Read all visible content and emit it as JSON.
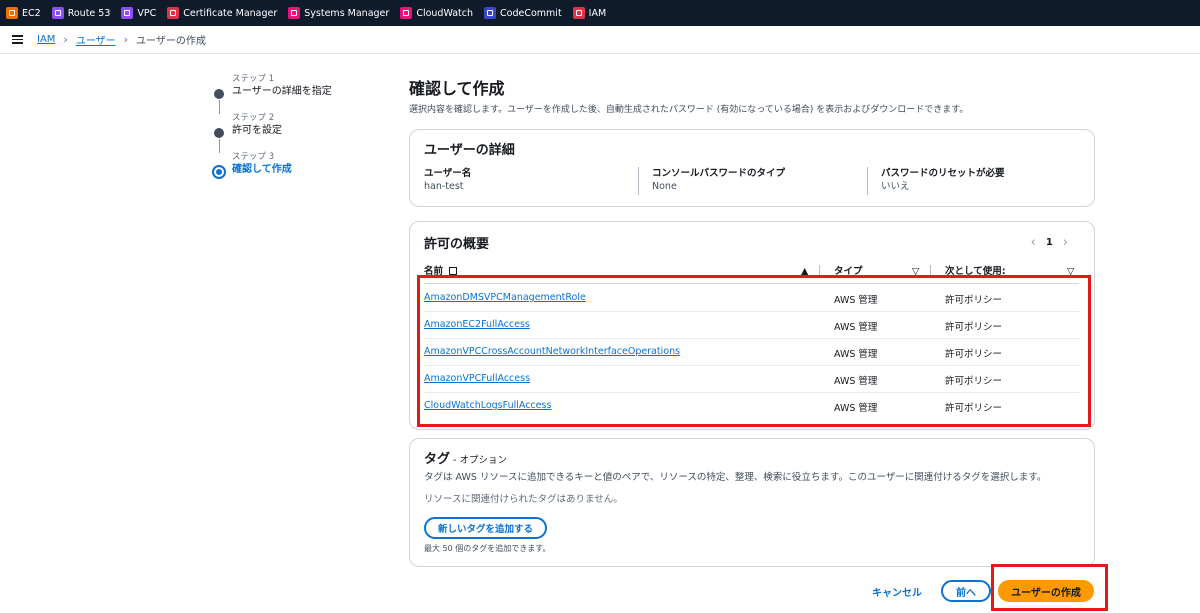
{
  "services": [
    {
      "label": "EC2",
      "color": "#ed7100"
    },
    {
      "label": "Route 53",
      "color": "#8c4fff"
    },
    {
      "label": "VPC",
      "color": "#8c4fff"
    },
    {
      "label": "Certificate Manager",
      "color": "#dd344c"
    },
    {
      "label": "Systems Manager",
      "color": "#e7157b"
    },
    {
      "label": "CloudWatch",
      "color": "#e7157b"
    },
    {
      "label": "CodeCommit",
      "color": "#3b48cc"
    },
    {
      "label": "IAM",
      "color": "#dd344c"
    }
  ],
  "breadcrumb": {
    "root": "IAM",
    "users": "ユーザー",
    "current": "ユーザーの作成"
  },
  "steps": [
    {
      "label": "ステップ 1",
      "title": "ユーザーの詳細を指定"
    },
    {
      "label": "ステップ 2",
      "title": "許可を設定"
    },
    {
      "label": "ステップ 3",
      "title": "確認して作成"
    }
  ],
  "page": {
    "title": "確認して作成",
    "description": "選択内容を確認します。ユーザーを作成した後、自動生成されたパスワード (有効になっている場合) を表示およびダウンロードできます。"
  },
  "user_details": {
    "title": "ユーザーの詳細",
    "username_label": "ユーザー名",
    "username": "han-test",
    "password_type_label": "コンソールパスワードのタイプ",
    "password_type": "None",
    "reset_label": "パスワードのリセットが必要",
    "reset": "いいえ"
  },
  "permissions": {
    "title": "許可の概要",
    "page": "1",
    "columns": {
      "name": "名前",
      "type": "タイプ",
      "used_as": "次として使用:"
    },
    "rows": [
      {
        "name": "AmazonDMSVPCManagementRole",
        "type": "AWS 管理",
        "used_as": "許可ポリシー"
      },
      {
        "name": "AmazonEC2FullAccess",
        "type": "AWS 管理",
        "used_as": "許可ポリシー"
      },
      {
        "name": "AmazonVPCCrossAccountNetworkInterfaceOperations",
        "type": "AWS 管理",
        "used_as": "許可ポリシー"
      },
      {
        "name": "AmazonVPCFullAccess",
        "type": "AWS 管理",
        "used_as": "許可ポリシー"
      },
      {
        "name": "CloudWatchLogsFullAccess",
        "type": "AWS 管理",
        "used_as": "許可ポリシー"
      }
    ]
  },
  "tags": {
    "title": "タグ",
    "optional": " - オプション",
    "description": "タグは AWS リソースに追加できるキーと値のペアで、リソースの特定、整理、検索に役立ちます。このユーザーに関連付けるタグを選択します。",
    "none": "リソースに関連付けられたタグはありません。",
    "add_button": "新しいタグを追加する",
    "limit": "最大 50 個のタグを追加できます。"
  },
  "footer": {
    "cancel": "キャンセル",
    "previous": "前へ",
    "create": "ユーザーの作成"
  }
}
